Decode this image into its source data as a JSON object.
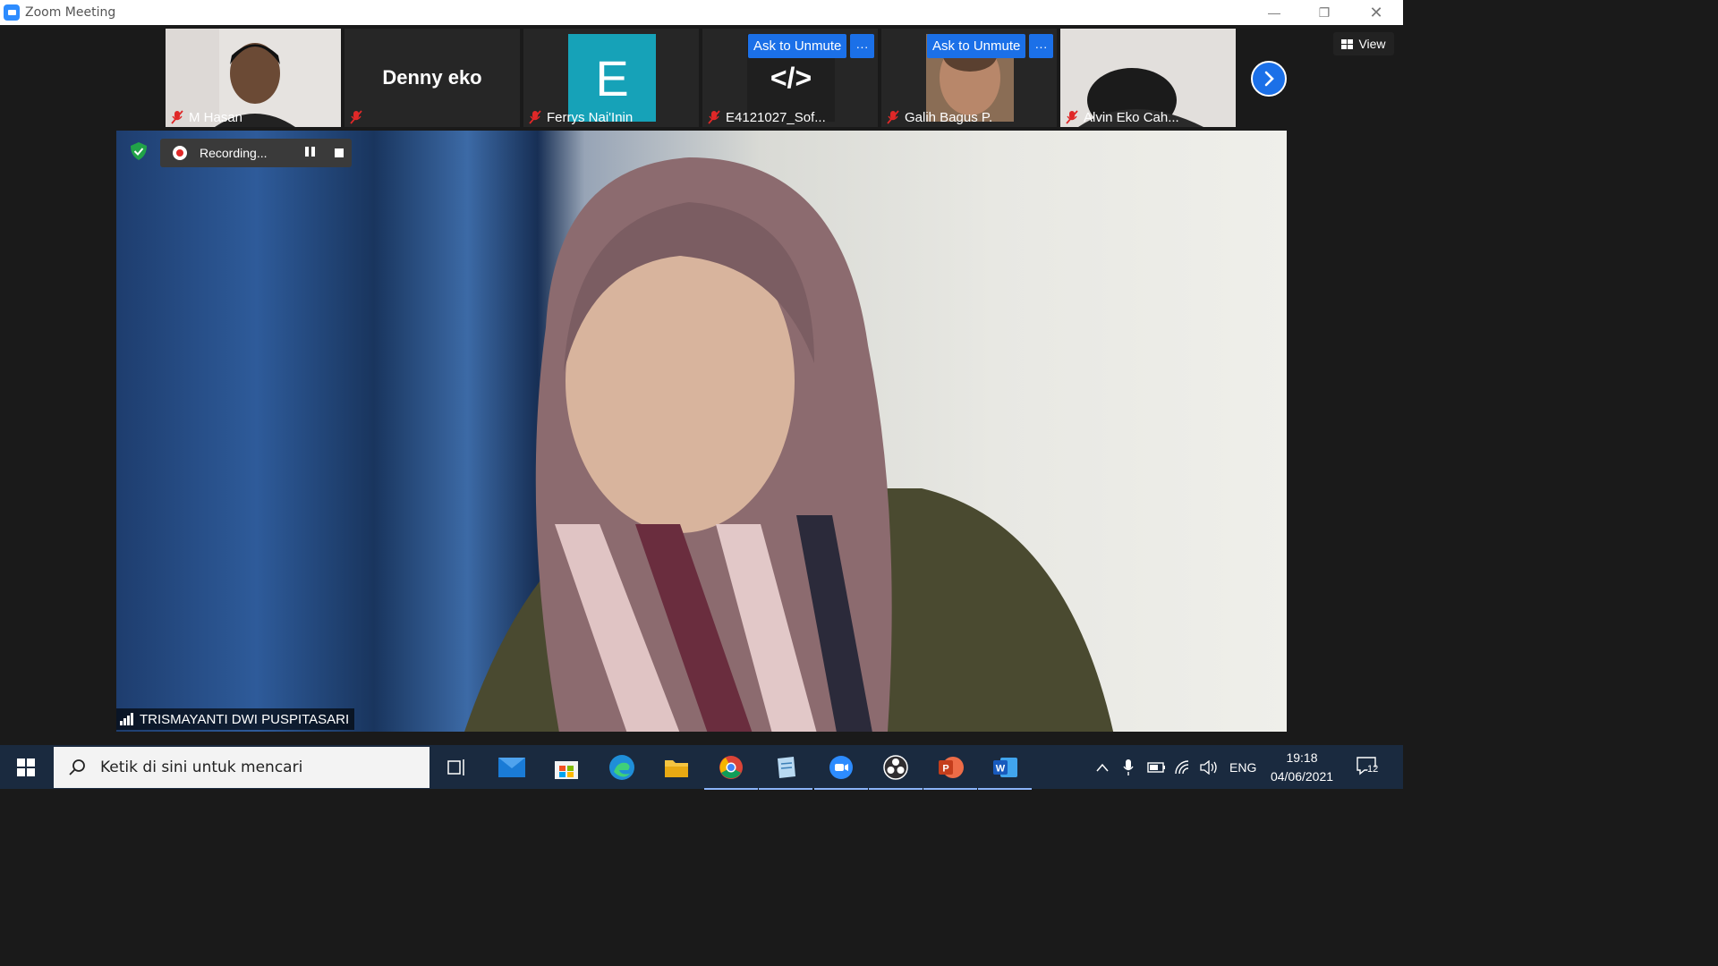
{
  "window": {
    "title": "Zoom Meeting"
  },
  "thumbnails": [
    {
      "name": "M Hasan",
      "type": "video"
    },
    {
      "name": "",
      "display_name": "Denny eko",
      "type": "name"
    },
    {
      "name": "Ferrys Nai'Inin",
      "type": "avatar",
      "avatar_letter": "E",
      "avatar_color": "#16a2b8"
    },
    {
      "name": "E4121027_Sof...",
      "type": "avatar",
      "avatar_letter": "</>",
      "ask_unmute": "Ask to Unmute",
      "more": "···"
    },
    {
      "name": "Galih Bagus P.",
      "type": "video",
      "ask_unmute": "Ask to Unmute",
      "more": "···"
    },
    {
      "name": "Alvin Eko Cah...",
      "type": "video"
    }
  ],
  "view_button": {
    "label": "View"
  },
  "recording": {
    "label": "Recording..."
  },
  "active_speaker": {
    "name": "TRISMAYANTI DWI PUSPITASARI"
  },
  "taskbar": {
    "search_placeholder": "Ketik di sini untuk mencari",
    "language": "ENG",
    "time": "19:18",
    "date": "04/06/2021",
    "notification_count": "12",
    "pinned_apps": [
      "task-view",
      "mail",
      "microsoft-store",
      "edge",
      "file-explorer",
      "chrome",
      "notepad",
      "zoom",
      "obs",
      "powerpoint",
      "word"
    ]
  },
  "colors": {
    "zoom_blue": "#1b70e8",
    "taskbar": "#1a2a3f",
    "muted_red": "#e02828"
  }
}
